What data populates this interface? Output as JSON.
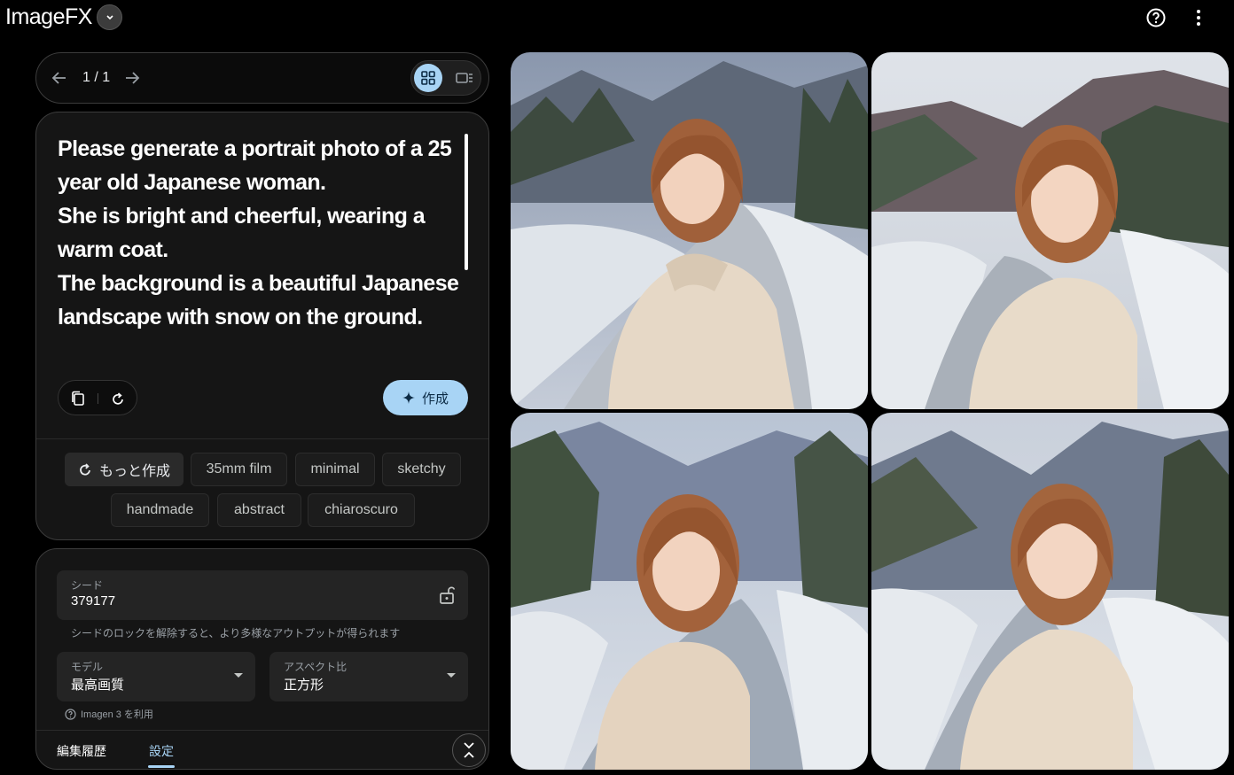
{
  "app": {
    "title": "ImageFX"
  },
  "pager": {
    "count": "1 / 1"
  },
  "prompt": {
    "text": "Please generate a portrait photo of a 25 year old Japanese woman.\nShe is bright and cheerful, wearing a warm coat.\nThe background is a beautiful Japanese landscape with snow on the ground.",
    "create_label": "作成"
  },
  "chips": {
    "more_label": "もっと作成",
    "items": [
      "35mm film",
      "minimal",
      "sketchy",
      "handmade",
      "abstract",
      "chiaroscuro"
    ]
  },
  "settings": {
    "seed_label": "シード",
    "seed_value": "379177",
    "seed_hint": "シードのロックを解除すると、より多様なアウトプットが得られます",
    "model_label": "モデル",
    "model_value": "最高画質",
    "aspect_label": "アスペクト比",
    "aspect_value": "正方形",
    "imagen_note": "Imagen 3 を利用"
  },
  "tabs": {
    "history": "編集履歴",
    "settings": "設定",
    "active": "settings"
  },
  "colors": {
    "accent": "#a8d4f5",
    "background": "#000000",
    "panel": "#151515"
  }
}
